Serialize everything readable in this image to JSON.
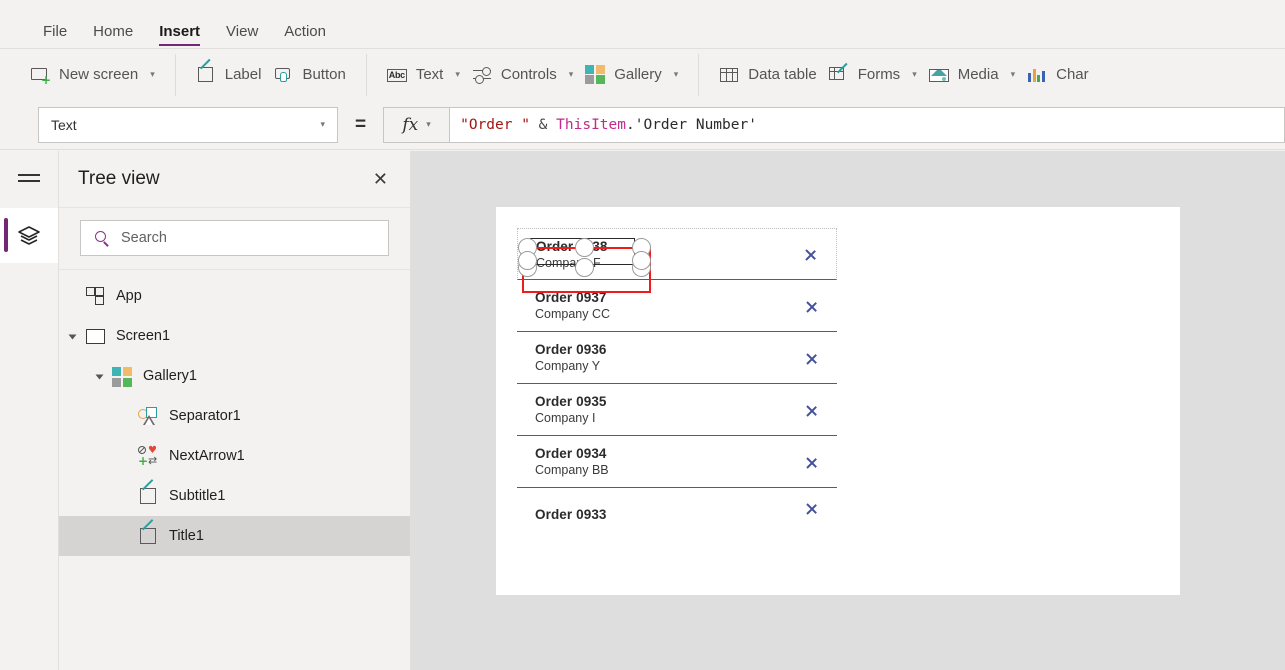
{
  "menu": {
    "items": [
      {
        "label": "File",
        "active": false
      },
      {
        "label": "Home",
        "active": false
      },
      {
        "label": "Insert",
        "active": true
      },
      {
        "label": "View",
        "active": false
      },
      {
        "label": "Action",
        "active": false
      }
    ]
  },
  "ribbon": {
    "groups": [
      {
        "items": [
          {
            "label": "New screen",
            "icon": "new-screen-icon",
            "caret": true
          }
        ]
      },
      {
        "items": [
          {
            "label": "Label",
            "icon": "label-icon",
            "caret": false
          },
          {
            "label": "Button",
            "icon": "button-icon",
            "caret": false
          }
        ]
      },
      {
        "items": [
          {
            "label": "Text",
            "icon": "text-abc-icon",
            "caret": true
          },
          {
            "label": "Controls",
            "icon": "controls-sliders-icon",
            "caret": true
          },
          {
            "label": "Gallery",
            "icon": "gallery-grid-icon",
            "caret": true
          }
        ]
      },
      {
        "items": [
          {
            "label": "Data table",
            "icon": "data-table-icon",
            "caret": false
          },
          {
            "label": "Forms",
            "icon": "forms-icon",
            "caret": true
          },
          {
            "label": "Media",
            "icon": "media-picture-icon",
            "caret": true
          },
          {
            "label": "Char",
            "icon": "charts-bar-icon",
            "caret": false
          }
        ]
      }
    ]
  },
  "formula_bar": {
    "property_selected": "Text",
    "equals_sign": "=",
    "fx_glyph": "fx",
    "formula_tokens": [
      {
        "text": "\"Order \"",
        "kind": "string"
      },
      {
        "text": " & ",
        "kind": "operator"
      },
      {
        "text": "ThisItem",
        "kind": "object"
      },
      {
        "text": ".'Order Number'",
        "kind": "punct"
      }
    ],
    "formula_full": "\"Order \" & ThisItem.'Order Number'"
  },
  "rail": {
    "hamburger": "hamburger-menu-icon",
    "active_tool": "tree-view-layers-icon"
  },
  "tree_view": {
    "title": "Tree view",
    "close_label": "✕",
    "search_placeholder": "Search",
    "items": [
      {
        "label": "App",
        "icon": "app-icon",
        "indent": 0,
        "expander": false,
        "selected": false
      },
      {
        "label": "Screen1",
        "icon": "screen-icon",
        "indent": 0,
        "expander": true,
        "selected": false
      },
      {
        "label": "Gallery1",
        "icon": "gallery-icon",
        "indent": 1,
        "expander": true,
        "selected": false
      },
      {
        "label": "Separator1",
        "icon": "shapes-icon",
        "indent": 2,
        "expander": false,
        "selected": false
      },
      {
        "label": "NextArrow1",
        "icon": "next-arrow-icon",
        "indent": 2,
        "expander": false,
        "selected": false
      },
      {
        "label": "Subtitle1",
        "icon": "label-icon",
        "indent": 2,
        "expander": false,
        "selected": false
      },
      {
        "label": "Title1",
        "icon": "label-icon",
        "indent": 2,
        "expander": false,
        "selected": true
      }
    ]
  },
  "canvas": {
    "gallery": {
      "rows": [
        {
          "title": "Order 0938",
          "subtitle": "Company F",
          "selected": true,
          "clipped": false
        },
        {
          "title": "Order 0937",
          "subtitle": "Company CC",
          "selected": false,
          "clipped": false
        },
        {
          "title": "Order 0936",
          "subtitle": "Company Y",
          "selected": false,
          "clipped": false
        },
        {
          "title": "Order 0935",
          "subtitle": "Company I",
          "selected": false,
          "clipped": false
        },
        {
          "title": "Order 0934",
          "subtitle": "Company BB",
          "selected": false,
          "clipped": false
        },
        {
          "title": "Order 0933",
          "subtitle": "",
          "selected": false,
          "clipped": true
        }
      ]
    }
  },
  "colors": {
    "accent_purple": "#742774",
    "selection_red": "#f01c1c",
    "chevron_blue": "#44539b",
    "chrome_gray": "#f3f2f1",
    "canvas_gray": "#dedede",
    "tree_selected": "#d6d4d2"
  }
}
